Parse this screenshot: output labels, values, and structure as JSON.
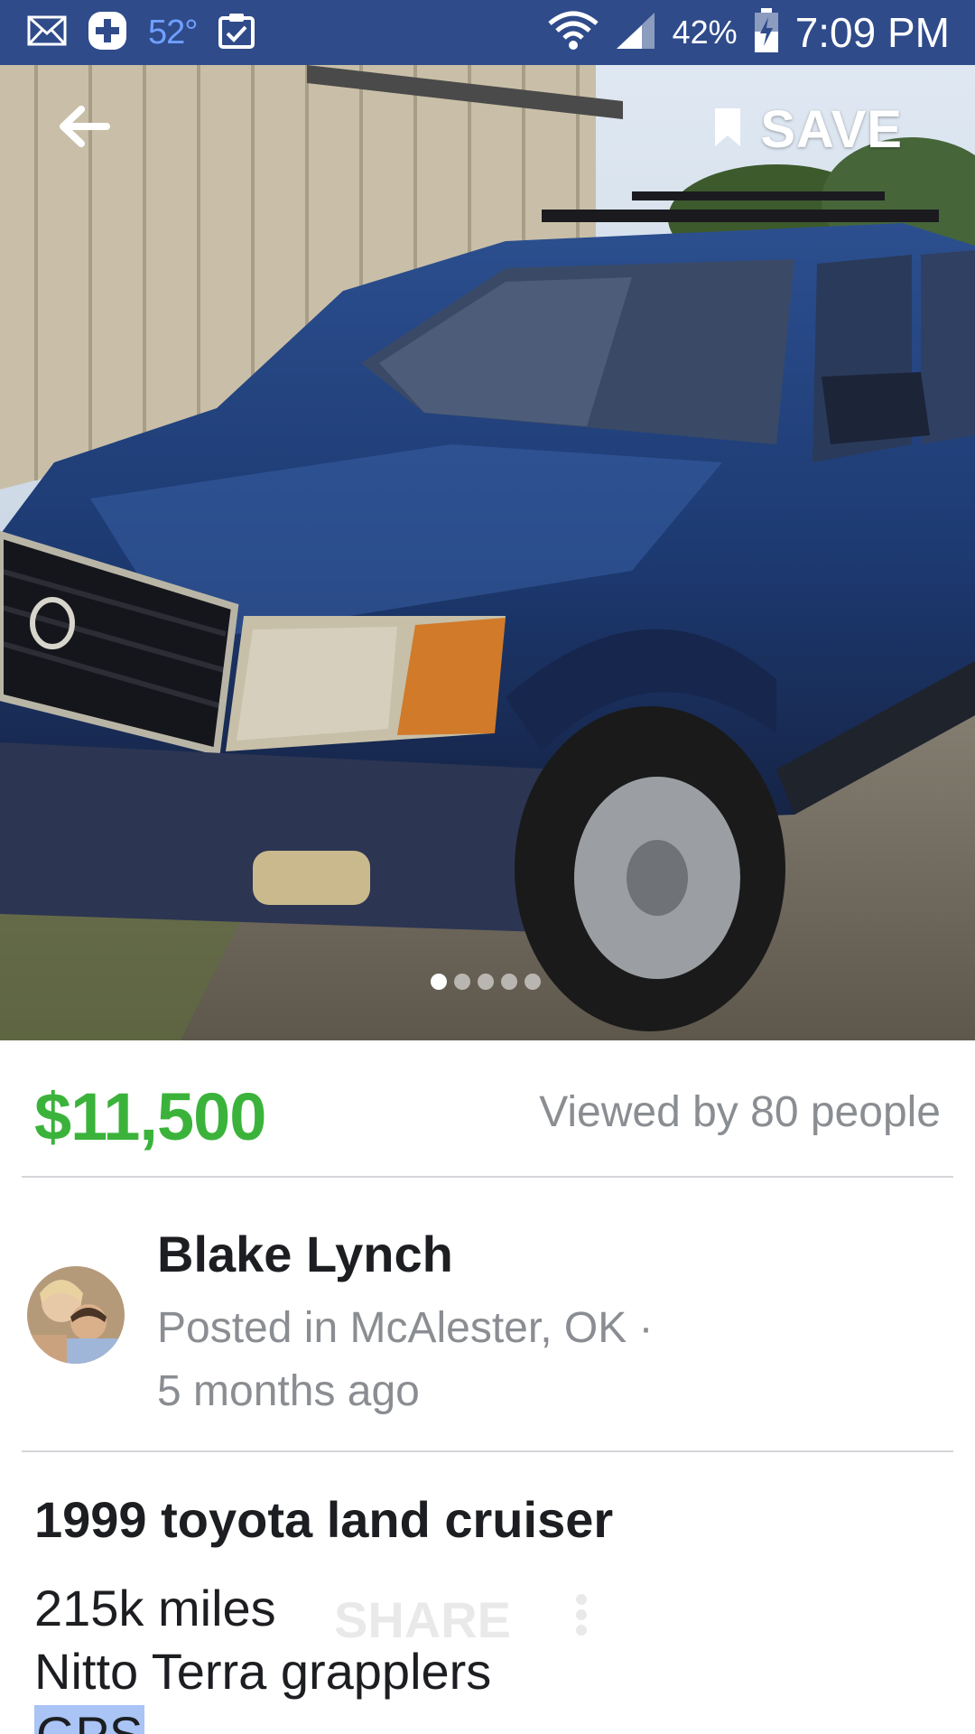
{
  "status_bar": {
    "temperature": "52°",
    "battery": "42%",
    "time": "7:09 PM"
  },
  "header": {
    "save_label": "SAVE"
  },
  "gallery": {
    "dots": [
      {
        "active": true
      },
      {
        "active": false
      },
      {
        "active": false
      },
      {
        "active": false
      },
      {
        "active": false
      }
    ]
  },
  "listing": {
    "price": "$11,500",
    "views": "Viewed by 80 people",
    "title": "1999 toyota land cruiser",
    "description": [
      "215k miles",
      "Nitto Terra grapplers",
      "GPS"
    ]
  },
  "seller": {
    "name": "Blake Lynch",
    "location": "Posted in McAlester, OK ·",
    "posted_ago": "5 months ago"
  },
  "ghost_actions": {
    "share_label": "SHARE"
  },
  "colors": {
    "status_bar_bg": "#2f4b8a",
    "price_green": "#3bb33b",
    "secondary_text": "#8a8d91"
  }
}
